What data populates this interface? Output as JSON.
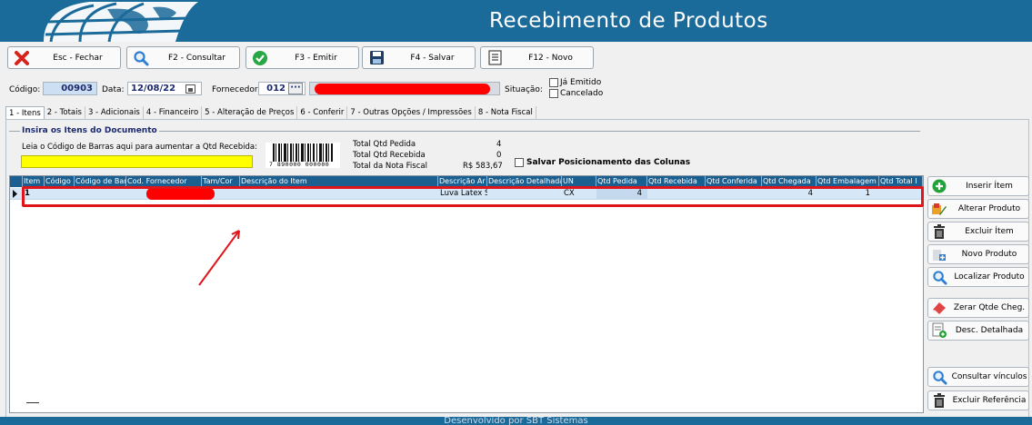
{
  "window": {
    "title": "Recebimento de Produtos"
  },
  "toolbar": [
    {
      "label": "Esc - Fechar",
      "icon": "close-icon"
    },
    {
      "label": "F2 - Consultar",
      "icon": "search-icon"
    },
    {
      "label": "F3 - Emitir",
      "icon": "check-icon"
    },
    {
      "label": "F4 - Salvar",
      "icon": "save-icon"
    },
    {
      "label": "F12 - Novo",
      "icon": "document-icon"
    }
  ],
  "header": {
    "codigo_label": "Código:",
    "codigo_value": "00903",
    "data_label": "Data:",
    "data_value": "12/08/22",
    "fornecedor_label": "Fornecedor:",
    "fornecedor_code": "012",
    "situacao_label": "Situação:",
    "situacao_options": [
      "Já Emitido",
      "Cancelado"
    ]
  },
  "tabs": [
    "1 - Itens",
    "2 - Totais",
    "3 - Adicionais",
    "4 - Financeiro",
    "5 - Alteração de Preços",
    "6 - Conferir",
    "7 - Outras Opções / Impressões",
    "8 - Nota Fiscal"
  ],
  "items_panel": {
    "group_title": "Insira os Itens do Documento",
    "barcode_prompt": "Leia o Código de Barras aqui para aumentar a Qtd Recebida:",
    "barcode_digits": "7 890000 000000",
    "totals": [
      {
        "label": "Total Qtd Pedida",
        "value": "4"
      },
      {
        "label": "Total Qtd Recebida",
        "value": "0"
      },
      {
        "label": "Total da Nota Fiscal",
        "value": "R$ 583,67"
      }
    ],
    "save_columns_label": "Salvar Posicionamento das Colunas"
  },
  "grid": {
    "columns": [
      "Item",
      "Código",
      "Código de Barras",
      "Cod. Fornecedor",
      "Tam/Cor",
      "Descrição do Item",
      "Descrição Ar",
      "Descrição Detalhada",
      "UN",
      "Qtd Pedida",
      "Qtd Recebida",
      "Qtd Conferida",
      "Qtd Chegada",
      "Qtd Embalagem",
      "Qtd Total I"
    ],
    "rows": [
      [
        "1",
        "",
        "",
        "",
        "",
        "",
        "Luva Latex S",
        "",
        "CX",
        "4",
        "",
        "",
        "4",
        "1",
        ""
      ]
    ]
  },
  "side_buttons": [
    {
      "label": "Inserir Ítem",
      "icon": "add-icon"
    },
    {
      "label": "Alterar Produto",
      "icon": "edit-product-icon"
    },
    {
      "label": "Excluir Ítem",
      "icon": "trash-icon"
    },
    {
      "label": "Novo Produto",
      "icon": "new-product-icon"
    },
    {
      "label": "Localizar Produto",
      "icon": "search-icon"
    },
    {
      "label": "Zerar Qtde Cheg.",
      "icon": "eraser-icon"
    },
    {
      "label": "Desc. Detalhada",
      "icon": "document-add-icon"
    },
    {
      "label": "Consultar vínculos",
      "icon": "search-icon"
    },
    {
      "label": "Excluir Referência",
      "icon": "trash-icon"
    }
  ],
  "footer": {
    "text": "Desenvolvido por SBT Sistemas"
  },
  "colors": {
    "brand": "#1a6a9a",
    "grid_header": "#1a5f90",
    "selection": "#d6e8f7",
    "highlight": "#ffff00",
    "annotation": "#e0151b"
  }
}
